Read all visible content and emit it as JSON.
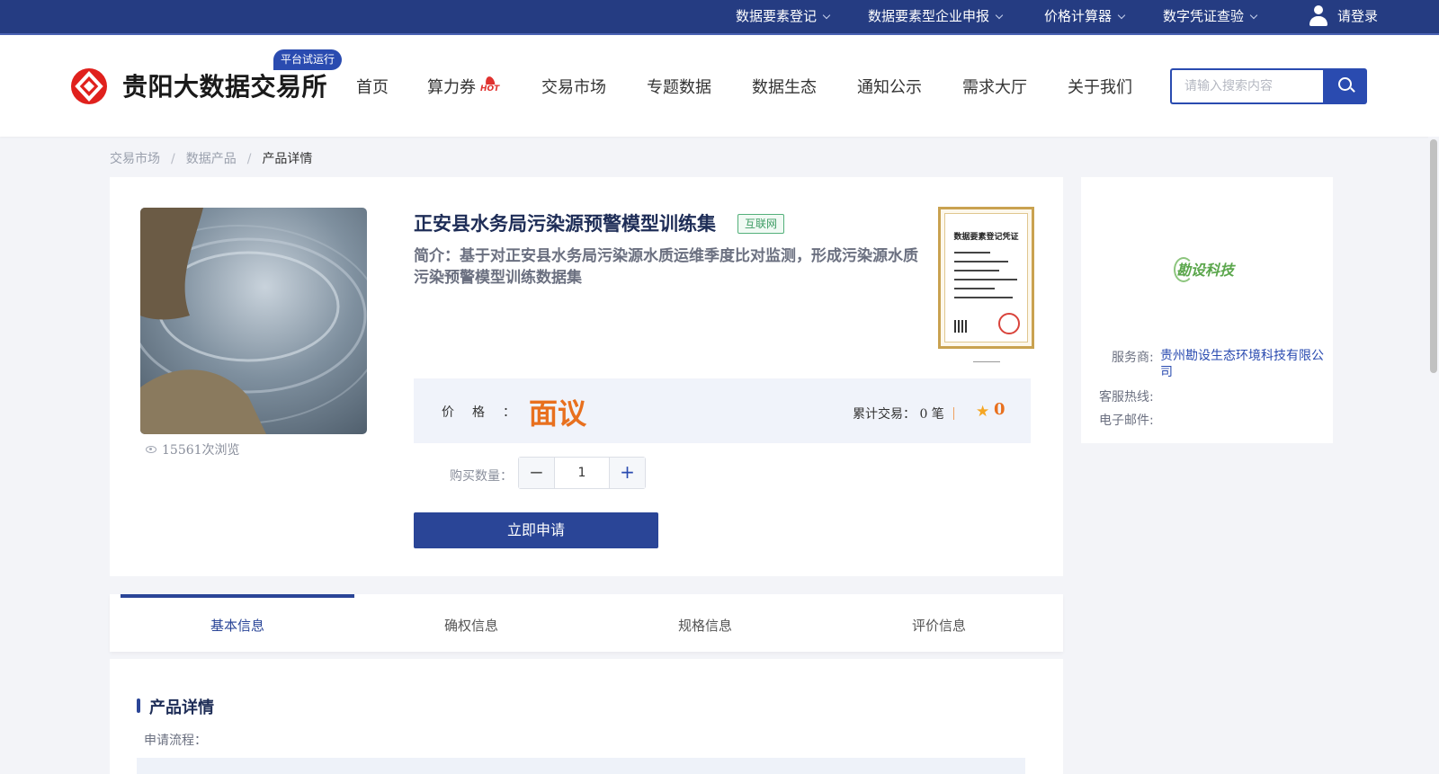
{
  "topbar": {
    "items": [
      "数据要素登记",
      "数据要素型企业申报",
      "价格计算器",
      "数字凭证查验"
    ],
    "login": "请登录"
  },
  "header": {
    "logo_text": "贵阳大数据交易所",
    "badge": "平台试运行",
    "nav": [
      "首页",
      "算力券",
      "交易市场",
      "专题数据",
      "数据生态",
      "通知公示",
      "需求大厅",
      "关于我们"
    ],
    "hot_label": "HOT",
    "search_placeholder": "请输入搜索内容"
  },
  "breadcrumb": [
    "交易市场",
    "数据产品",
    "产品详情"
  ],
  "breadcrumb_sep": "/",
  "product": {
    "views": "15561次浏览",
    "title": "正安县水务局污染源预警模型训练集",
    "tag": "互联网",
    "intro": "简介：基于对正安县水务局污染源水质运维季度比对监测，形成污染源水质污染预警模型训练数据集",
    "cert_title": "数据要素登记凭证",
    "price_label": "价格：",
    "price_value": "面议",
    "trade_count": "累计交易： 0 笔",
    "rating": "0",
    "qty_label": "购买数量：",
    "qty_value": "1",
    "minus": "−",
    "plus": "+",
    "apply": "立即申请"
  },
  "provider": {
    "logo_text": "勘设科技",
    "service_label": "服务商:",
    "service_value": "贵州勘设生态环境科技有限公司",
    "hotline_label": "客服热线:",
    "email_label": "电子邮件:"
  },
  "tabs": [
    "基本信息",
    "确权信息",
    "规格信息",
    "评价信息"
  ],
  "details": {
    "title": "产品详情",
    "sub": "申请流程："
  },
  "colors": {
    "topbar": "#253c82",
    "primary": "#2a4597",
    "price": "#e8701e",
    "tag_green": "#3f9d65"
  }
}
